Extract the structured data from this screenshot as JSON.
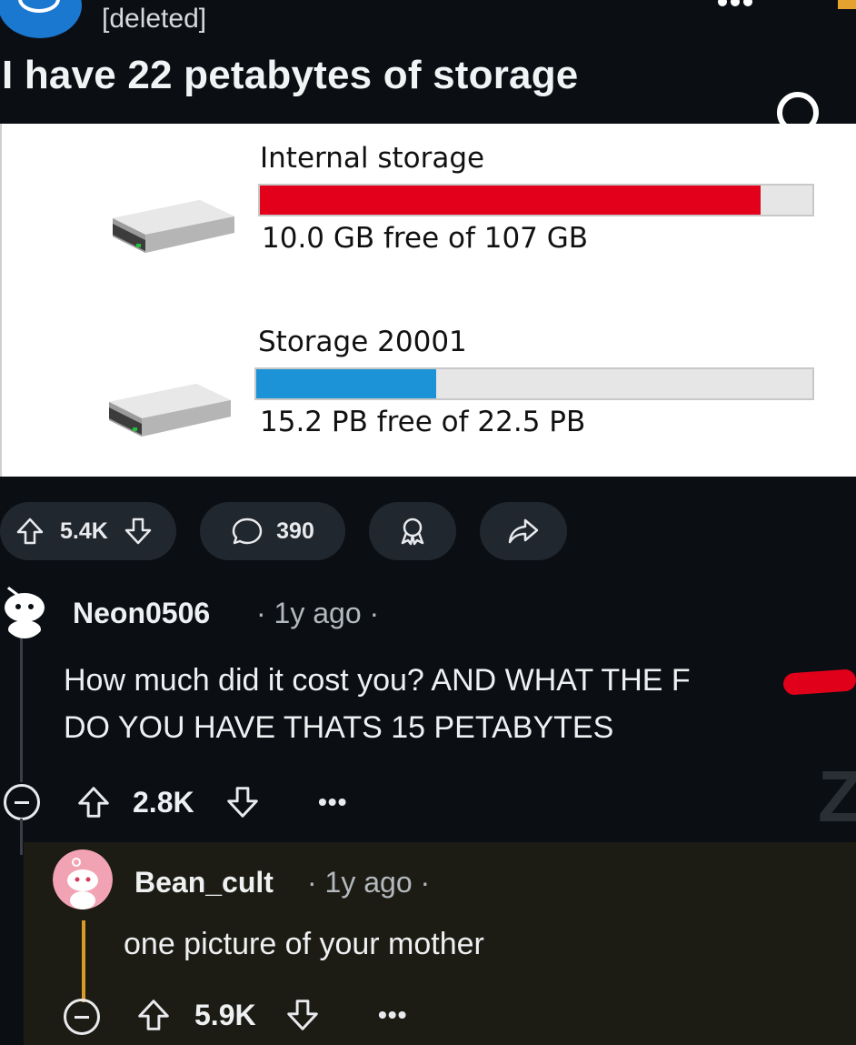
{
  "post": {
    "author": "[deleted]",
    "title": "I have 22 petabytes of storage"
  },
  "image": {
    "drives": [
      {
        "name": "Internal storage",
        "caption": "10.0 GB free of 107 GB",
        "used_fraction": 0.907,
        "bar_color": "#e3001b"
      },
      {
        "name": "Storage 20001",
        "caption": "15.2 PB free of 22.5 PB",
        "used_fraction": 0.324,
        "bar_color": "#1b93d6"
      }
    ]
  },
  "actions": {
    "votes": "5.4K",
    "comments": "390"
  },
  "comments": [
    {
      "user": "Neon0506",
      "time": "1y ago",
      "text_line1": "How much did it cost you? AND WHAT THE F",
      "text_line2": "DO YOU HAVE THATS 15 PETABYTES",
      "votes": "2.8K",
      "more": "•••"
    },
    {
      "user": "Bean_cult",
      "time": "1y ago",
      "text": "one picture of your mother",
      "votes": "5.9K",
      "more": "•••"
    }
  ],
  "colors": {
    "background": "#0b0f14",
    "pill": "#21272e",
    "reply_accent": "#d99a2b"
  }
}
